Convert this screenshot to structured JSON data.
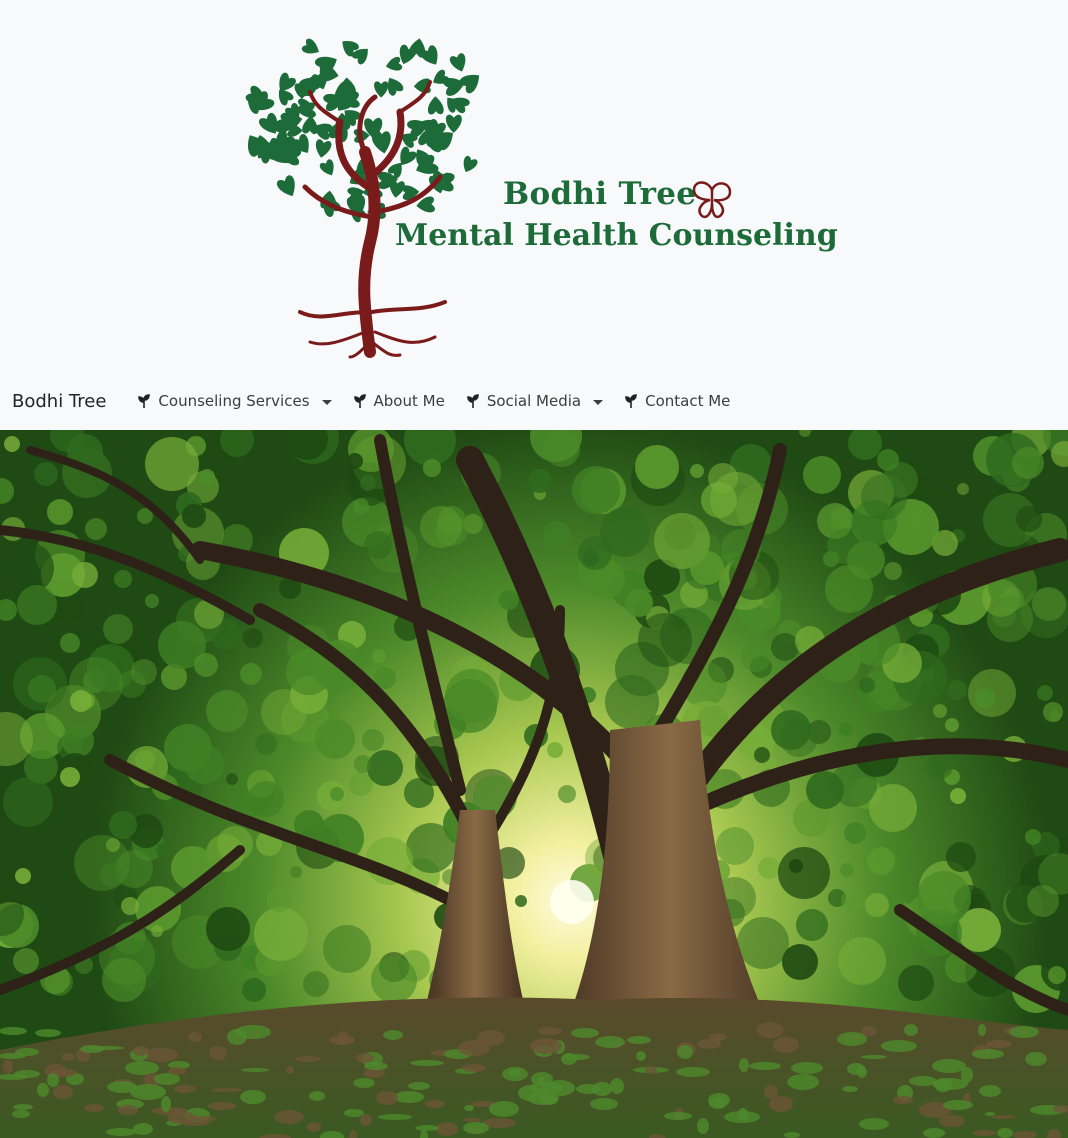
{
  "logo": {
    "line1": "Bodhi Tree",
    "line2": "Mental Health Counseling",
    "colors": {
      "leaf": "#1e6b3a",
      "trunk": "#7a1b1b",
      "text": "#1e6b3a"
    }
  },
  "navbar": {
    "brand": "Bodhi Tree",
    "items": [
      {
        "label": "Counseling Services",
        "icon": "sprout-icon",
        "dropdown": true
      },
      {
        "label": "About Me",
        "icon": "sprout-icon",
        "dropdown": false
      },
      {
        "label": "Social Media",
        "icon": "sprout-icon",
        "dropdown": true
      },
      {
        "label": "Contact Me",
        "icon": "sprout-icon",
        "dropdown": false
      }
    ]
  },
  "hero": {
    "image": "forest-trees-sunlight-photo"
  }
}
